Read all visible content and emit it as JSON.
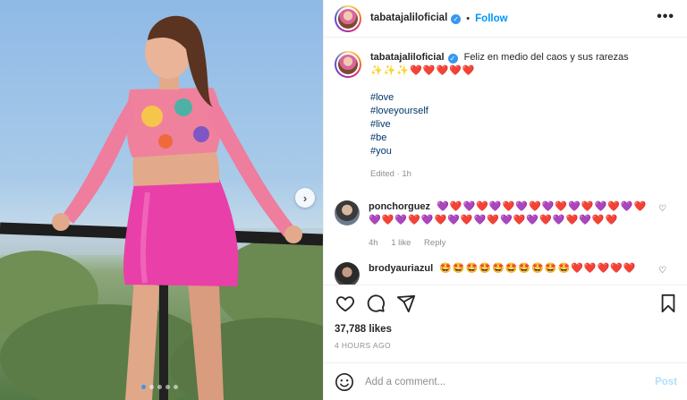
{
  "post": {
    "username": "tabatajaliloficial",
    "follow_label": "Follow",
    "separator": "•",
    "more_label": "•••",
    "caption_text": "Feliz en medio del caos y sus rarezas",
    "caption_emojis": "✨✨✨❤️❤️❤️❤️❤️",
    "hashtags": [
      "#love",
      "#loveyourself",
      "#live",
      "#be",
      "#you"
    ],
    "edited": "Edited · 1h",
    "likes": "37,788 likes",
    "time": "4 HOURS AGO"
  },
  "comments": [
    {
      "username": "ponchorguez",
      "text": "💜❤️💜❤️💜❤️💜❤️💜❤️💜❤️💜❤️💜❤️💜❤️💜❤️💜❤️💜❤️💜❤️💜❤️💜❤️💜❤️💜❤️❤️",
      "time": "4h",
      "likes": "1 like",
      "reply": "Reply"
    },
    {
      "username": "brodyauriazul",
      "text": "🤩🤩🤩🤩🤩🤩🤩🤩🤩🤩❤️❤️❤️❤️❤️"
    }
  ],
  "comment_box": {
    "placeholder": "Add a comment...",
    "post_label": "Post"
  },
  "carousel": {
    "next_label": "›",
    "slides": 5,
    "active_index": 0
  },
  "colors": {
    "accent": "#0095f6",
    "verified": "#3897f0",
    "hashtag": "#00376b"
  },
  "icons": [
    "verified-icon",
    "more-icon",
    "heart-icon",
    "comment-icon",
    "share-icon",
    "bookmark-icon",
    "emoji-icon",
    "carousel-next-icon"
  ]
}
